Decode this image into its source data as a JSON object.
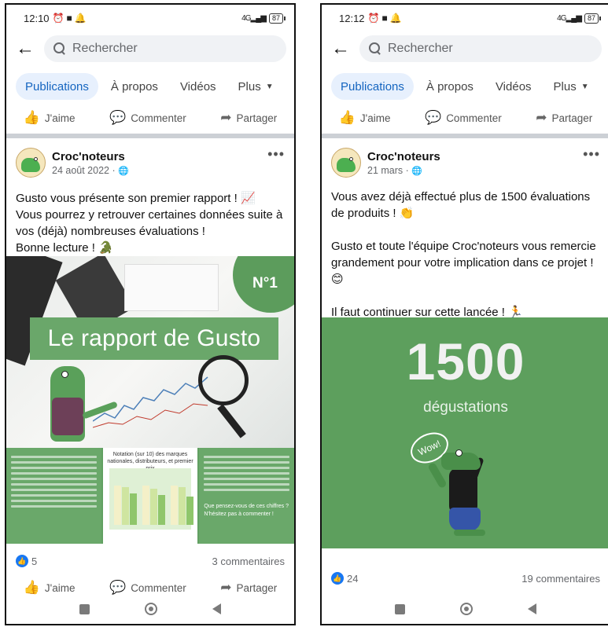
{
  "phones": [
    {
      "status": {
        "time": "12:10",
        "signal": "4G",
        "battery": "87"
      },
      "search": {
        "placeholder": "Rechercher"
      },
      "tabs": [
        {
          "label": "Publications",
          "active": true
        },
        {
          "label": "À propos"
        },
        {
          "label": "Vidéos"
        },
        {
          "label": "Plus"
        }
      ],
      "top_actions": {
        "like": "J'aime",
        "comment": "Commenter",
        "share": "Partager"
      },
      "post": {
        "author": "Croc'noteurs",
        "date": "24 août 2022",
        "lines": [
          "Gusto vous présente son premier rapport ! 📈",
          "Vous pourrez y retrouver certaines données suite à vos (déjà) nombreuses évaluations !",
          "Bonne lecture ! 🐊"
        ],
        "image": {
          "badge": "N°1",
          "title": "Le rapport de Gusto",
          "strip_chart_title": "Notation (sur 10) des marques nationales, distributeurs, et premier prix",
          "strip_question": "Que pensez-vous de ces chiffres ? N'hésitez pas à commenter !"
        },
        "reactions": {
          "count": "5",
          "comments": "3 commentaires"
        }
      },
      "bottom_actions": {
        "like": "J'aime",
        "comment": "Commenter",
        "share": "Partager"
      }
    },
    {
      "status": {
        "time": "12:12",
        "signal": "4G",
        "battery": "87"
      },
      "search": {
        "placeholder": "Rechercher"
      },
      "tabs": [
        {
          "label": "Publications",
          "active": true
        },
        {
          "label": "À propos"
        },
        {
          "label": "Vidéos"
        },
        {
          "label": "Plus"
        }
      ],
      "top_actions": {
        "like": "J'aime",
        "comment": "Commenter",
        "share": "Partager"
      },
      "post": {
        "author": "Croc'noteurs",
        "date": "21 mars",
        "paragraphs": [
          "Vous avez déjà effectué plus de 1500 évaluations de produits ! 👏",
          "Gusto et toute l'équipe Croc'noteurs vous remercie grandement pour votre implication dans ce projet ! 😊",
          "Il faut continuer sur cette lancée ! 🏃"
        ],
        "image": {
          "number": "1500",
          "label": "dégustations",
          "bubble": "Wow!"
        },
        "reactions": {
          "count": "24",
          "comments": "19 commentaires"
        }
      }
    }
  ],
  "colors": {
    "accent": "#1565c0",
    "active_tab_bg": "#e7f0fd",
    "brand_green": "#5d9f5d",
    "like_blue": "#1877f2"
  },
  "icons": {
    "back": "back-arrow-icon",
    "search": "search-icon",
    "like": "thumbs-up-icon",
    "comment": "comment-icon",
    "share": "share-icon",
    "menu": "more-horizontal-icon",
    "privacy": "globe-icon"
  }
}
